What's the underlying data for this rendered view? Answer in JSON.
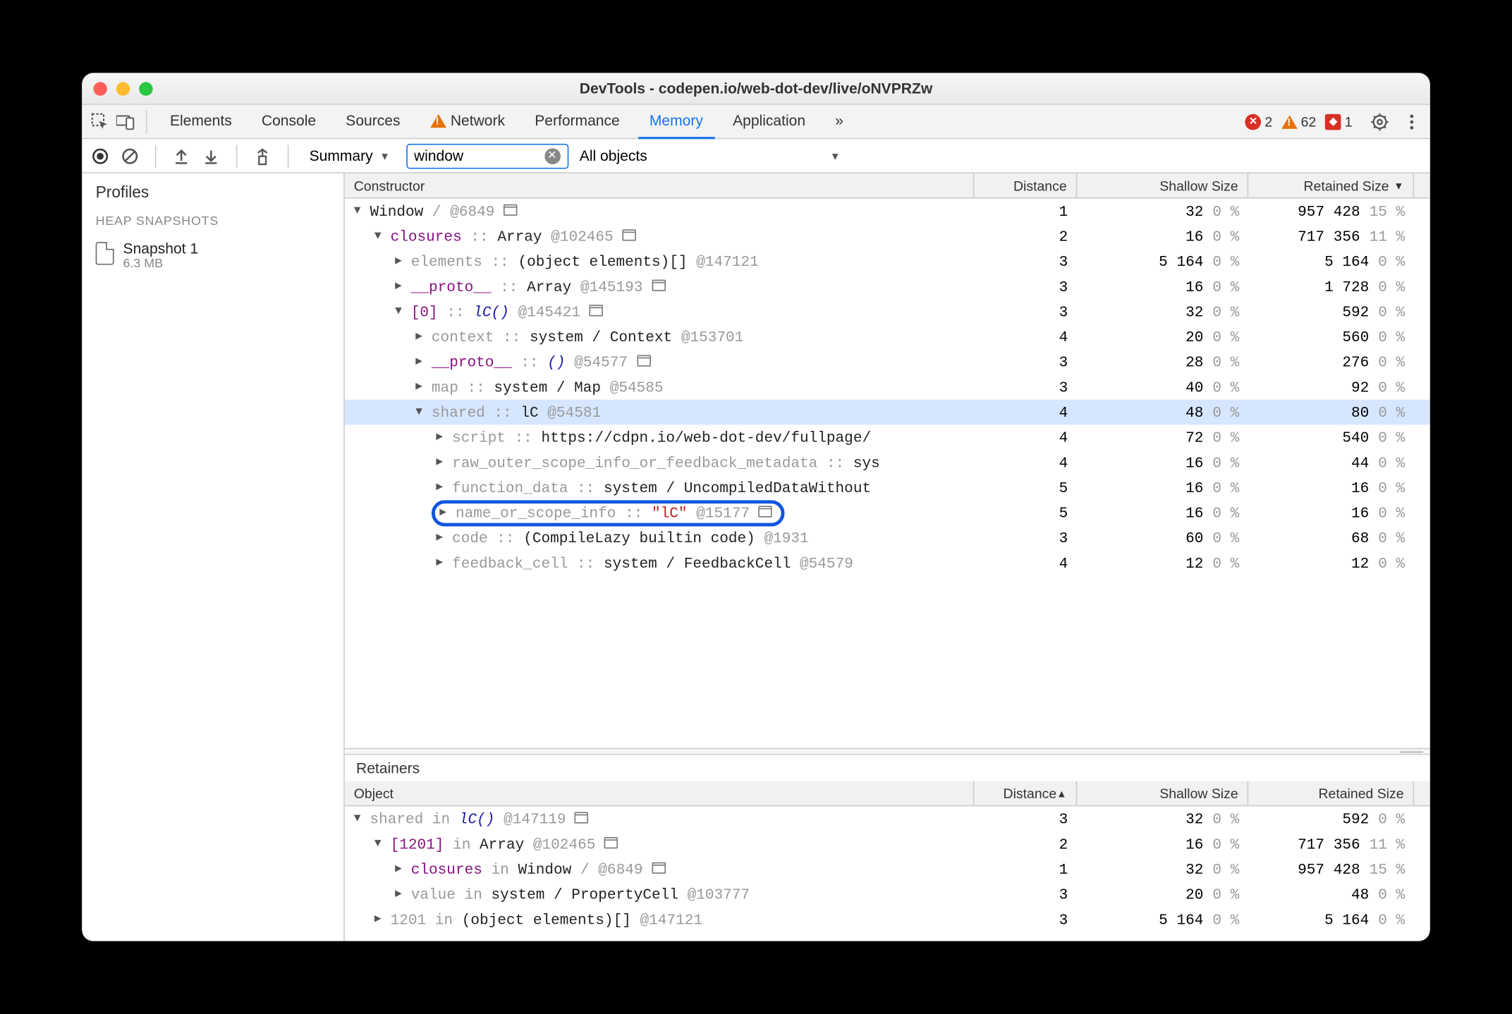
{
  "window": {
    "title": "DevTools - codepen.io/web-dot-dev/live/oNVPRZw"
  },
  "tabs": {
    "elements": "Elements",
    "console": "Console",
    "sources": "Sources",
    "network": "Network",
    "performance": "Performance",
    "memory": "Memory",
    "application": "Application",
    "more": "»"
  },
  "badges": {
    "errors": "2",
    "warnings": "62",
    "issues": "1"
  },
  "toolbar": {
    "summary": "Summary",
    "search_value": "window",
    "all_objects": "All objects"
  },
  "sidebar": {
    "profiles": "Profiles",
    "section": "HEAP SNAPSHOTS",
    "snapshot_name": "Snapshot 1",
    "snapshot_size": "6.3 MB"
  },
  "top_headers": {
    "constructor": "Constructor",
    "distance": "Distance",
    "shallow": "Shallow Size",
    "retained": "Retained Size"
  },
  "rows": [
    {
      "indent": 0,
      "arrow": "down",
      "label_html": "<span class='black'>Window</span> <span class='grey'>/</span>   <span class='grey'>@6849</span> <span class='winico'></span>",
      "dist": "1",
      "sh": "32",
      "shp": "0 %",
      "re": "957 428",
      "rep": "15 %"
    },
    {
      "indent": 1,
      "arrow": "down",
      "label_html": "<span class='purple'>closures</span> <span class='grey'>::</span> <span class='black'>Array</span> <span class='grey'>@102465</span> <span class='winico'></span>",
      "dist": "2",
      "sh": "16",
      "shp": "0 %",
      "re": "717 356",
      "rep": "11 %"
    },
    {
      "indent": 2,
      "arrow": "right",
      "label_html": "<span class='grey'>elements ::</span> <span class='black'>(object elements)[]</span> <span class='grey'>@147121</span>",
      "dist": "3",
      "sh": "5 164",
      "shp": "0 %",
      "re": "5 164",
      "rep": "0 %"
    },
    {
      "indent": 2,
      "arrow": "right",
      "label_html": "<span class='purple'>__proto__</span> <span class='grey'>::</span> <span class='black'>Array</span> <span class='grey'>@145193</span> <span class='winico'></span>",
      "dist": "3",
      "sh": "16",
      "shp": "0 %",
      "re": "1 728",
      "rep": "0 %"
    },
    {
      "indent": 2,
      "arrow": "down",
      "label_html": "<span class='purple'>[0]</span> <span class='grey'>::</span> <span class='blue'><i>lC()</i></span> <span class='grey'>@145421</span> <span class='winico'></span>",
      "dist": "3",
      "sh": "32",
      "shp": "0 %",
      "re": "592",
      "rep": "0 %"
    },
    {
      "indent": 3,
      "arrow": "right",
      "label_html": "<span class='grey'>context ::</span> <span class='black'>system / Context</span> <span class='grey'>@153701</span>",
      "dist": "4",
      "sh": "20",
      "shp": "0 %",
      "re": "560",
      "rep": "0 %"
    },
    {
      "indent": 3,
      "arrow": "right",
      "label_html": "<span class='purple'>__proto__</span> <span class='grey'>::</span> <span class='blue'><i>()</i></span> <span class='grey'>@54577</span> <span class='winico'></span>",
      "dist": "3",
      "sh": "28",
      "shp": "0 %",
      "re": "276",
      "rep": "0 %"
    },
    {
      "indent": 3,
      "arrow": "right",
      "label_html": "<span class='grey'>map ::</span> <span class='black'>system / Map</span> <span class='grey'>@54585</span>",
      "dist": "3",
      "sh": "40",
      "shp": "0 %",
      "re": "92",
      "rep": "0 %"
    },
    {
      "indent": 3,
      "arrow": "down",
      "sel": true,
      "label_html": "<span class='grey'>shared ::</span> <span class='black'>lC</span> <span class='grey'>@54581</span>",
      "dist": "4",
      "sh": "48",
      "shp": "0 %",
      "re": "80",
      "rep": "0 %"
    },
    {
      "indent": 4,
      "arrow": "right",
      "label_html": "<span class='grey'>script ::</span> <span class='black'>https://cdpn.io/web-dot-dev/fullpage/</span>",
      "dist": "4",
      "sh": "72",
      "shp": "0 %",
      "re": "540",
      "rep": "0 %"
    },
    {
      "indent": 4,
      "arrow": "right",
      "label_html": "<span class='grey'>raw_outer_scope_info_or_feedback_metadata ::</span> <span class='black'>sys</span>",
      "dist": "4",
      "sh": "16",
      "shp": "0 %",
      "re": "44",
      "rep": "0 %"
    },
    {
      "indent": 4,
      "arrow": "right",
      "label_html": "<span class='grey'>function_data ::</span> <span class='black'>system / UncompiledDataWithout</span>",
      "dist": "5",
      "sh": "16",
      "shp": "0 %",
      "re": "16",
      "rep": "0 %"
    },
    {
      "indent": 4,
      "arrow": "right",
      "oval": true,
      "label_html": "<span class='grey'>name_or_scope_info ::</span> <span class='red2'>\"lC\"</span> <span class='grey'>@15177</span> <span class='winico'></span>",
      "dist": "5",
      "sh": "16",
      "shp": "0 %",
      "re": "16",
      "rep": "0 %"
    },
    {
      "indent": 4,
      "arrow": "right",
      "label_html": "<span class='grey'>code ::</span> <span class='black'>(CompileLazy builtin code)</span> <span class='grey'>@1931</span>",
      "dist": "3",
      "sh": "60",
      "shp": "0 %",
      "re": "68",
      "rep": "0 %"
    },
    {
      "indent": 4,
      "arrow": "right",
      "label_html": "<span class='grey'>feedback_cell ::</span> <span class='black'>system / FeedbackCell</span> <span class='grey'>@54579</span>",
      "dist": "4",
      "sh": "12",
      "shp": "0 %",
      "re": "12",
      "rep": "0 %"
    }
  ],
  "retainers_title": "Retainers",
  "bottom_headers": {
    "object": "Object",
    "distance": "Distance",
    "shallow": "Shallow Size",
    "retained": "Retained Size"
  },
  "retainer_rows": [
    {
      "indent": 0,
      "arrow": "down",
      "label_html": "<span class='grey'>shared in</span> <span class='blue'><i>lC()</i></span> <span class='grey'>@147119</span> <span class='winico'></span>",
      "dist": "3",
      "sh": "32",
      "shp": "0 %",
      "re": "592",
      "rep": "0 %"
    },
    {
      "indent": 1,
      "arrow": "down",
      "label_html": "<span class='purple'>[1201]</span> <span class='grey'>in</span> <span class='black'>Array</span> <span class='grey'>@102465</span> <span class='winico'></span>",
      "dist": "2",
      "sh": "16",
      "shp": "0 %",
      "re": "717 356",
      "rep": "11 %"
    },
    {
      "indent": 2,
      "arrow": "right",
      "label_html": "<span class='purple'>closures</span> <span class='grey'>in</span> <span class='black'>Window</span> <span class='grey'>/</span>   <span class='grey'>@6849</span> <span class='winico'></span>",
      "dist": "1",
      "sh": "32",
      "shp": "0 %",
      "re": "957 428",
      "rep": "15 %"
    },
    {
      "indent": 2,
      "arrow": "right",
      "label_html": "<span class='grey'>value in</span> <span class='black'>system / PropertyCell</span> <span class='grey'>@103777</span>",
      "dist": "3",
      "sh": "20",
      "shp": "0 %",
      "re": "48",
      "rep": "0 %"
    },
    {
      "indent": 1,
      "arrow": "right",
      "label_html": "<span class='grey'>1201 in</span> <span class='black'>(object elements)[]</span> <span class='grey'>@147121</span>",
      "dist": "3",
      "sh": "5 164",
      "shp": "0 %",
      "re": "5 164",
      "rep": "0 %"
    }
  ]
}
